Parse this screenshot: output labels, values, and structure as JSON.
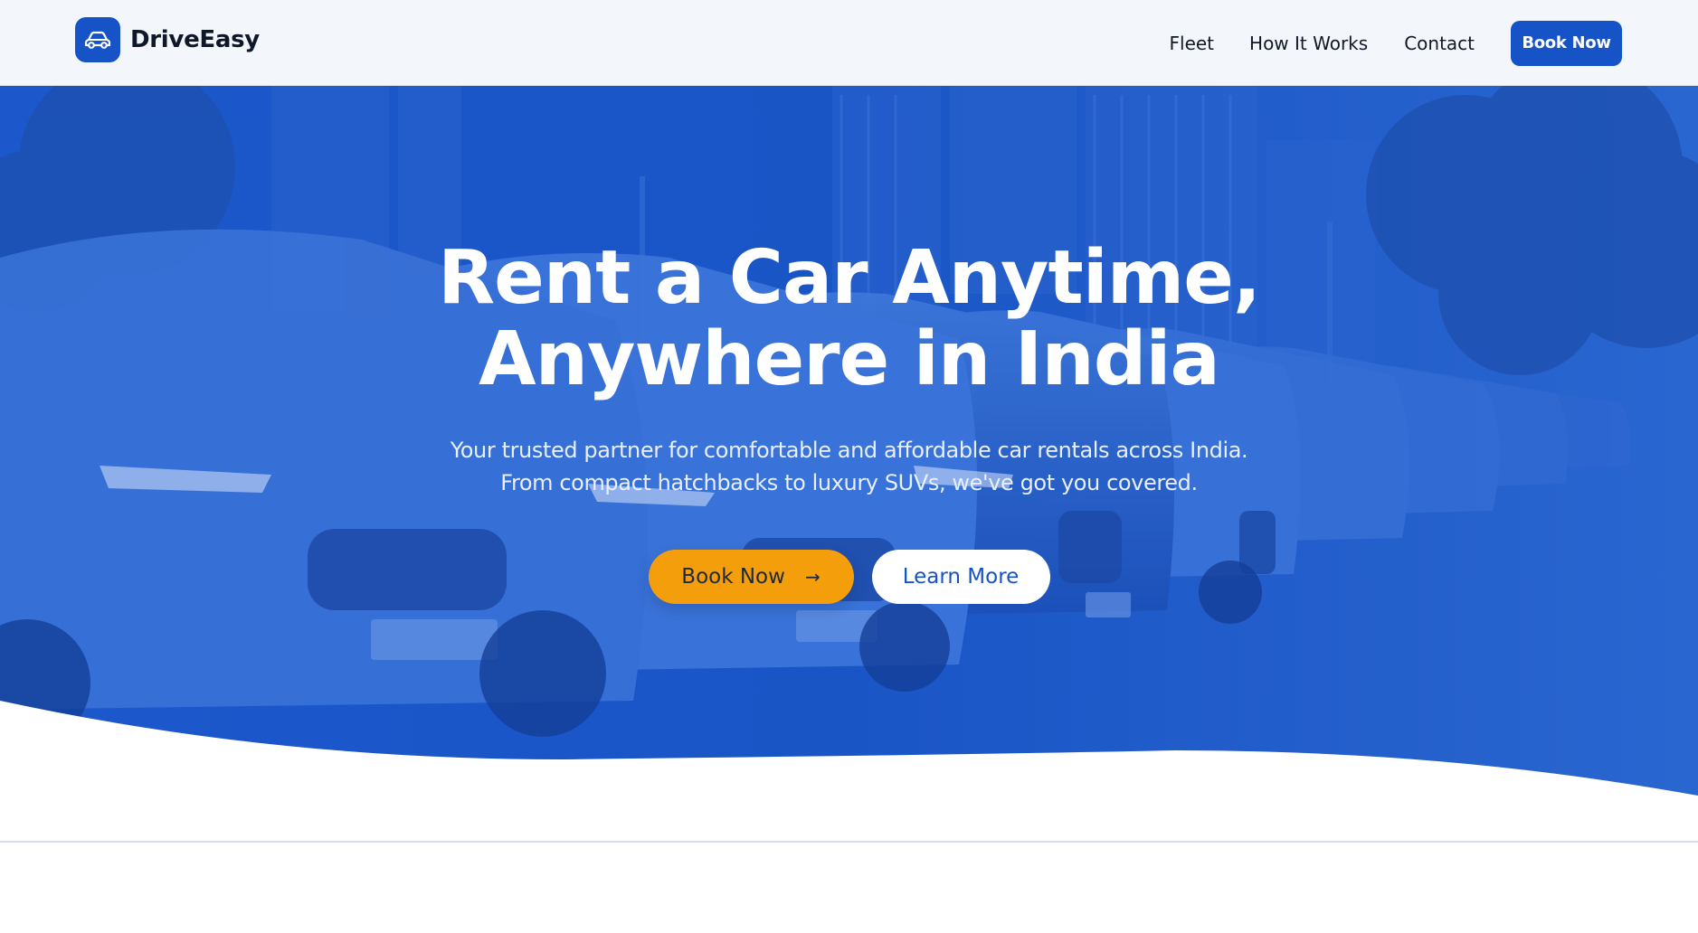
{
  "brand": {
    "name": "DriveEasy",
    "logo_icon": "car-icon"
  },
  "nav": {
    "links": [
      "Fleet",
      "How It Works",
      "Contact"
    ],
    "cta": "Book Now"
  },
  "hero": {
    "title_line1": "Rent a Car Anytime,",
    "title_line2": "Anywhere in India",
    "subtitle_line1": "Your trusted partner for comfortable and affordable car rentals across India.",
    "subtitle_line2": "From compact hatchbacks to luxury SUVs, we've got you covered.",
    "primary_button": "Book Now",
    "primary_button_icon": "arrow-right-icon",
    "secondary_button": "Learn More",
    "background": "row-of-parked-cars-photo"
  },
  "colors": {
    "brand_blue": "#1553c6",
    "hero_blue": "#1a56c9",
    "accent_orange": "#f59e0b",
    "navbar_bg": "#f3f6fb"
  }
}
